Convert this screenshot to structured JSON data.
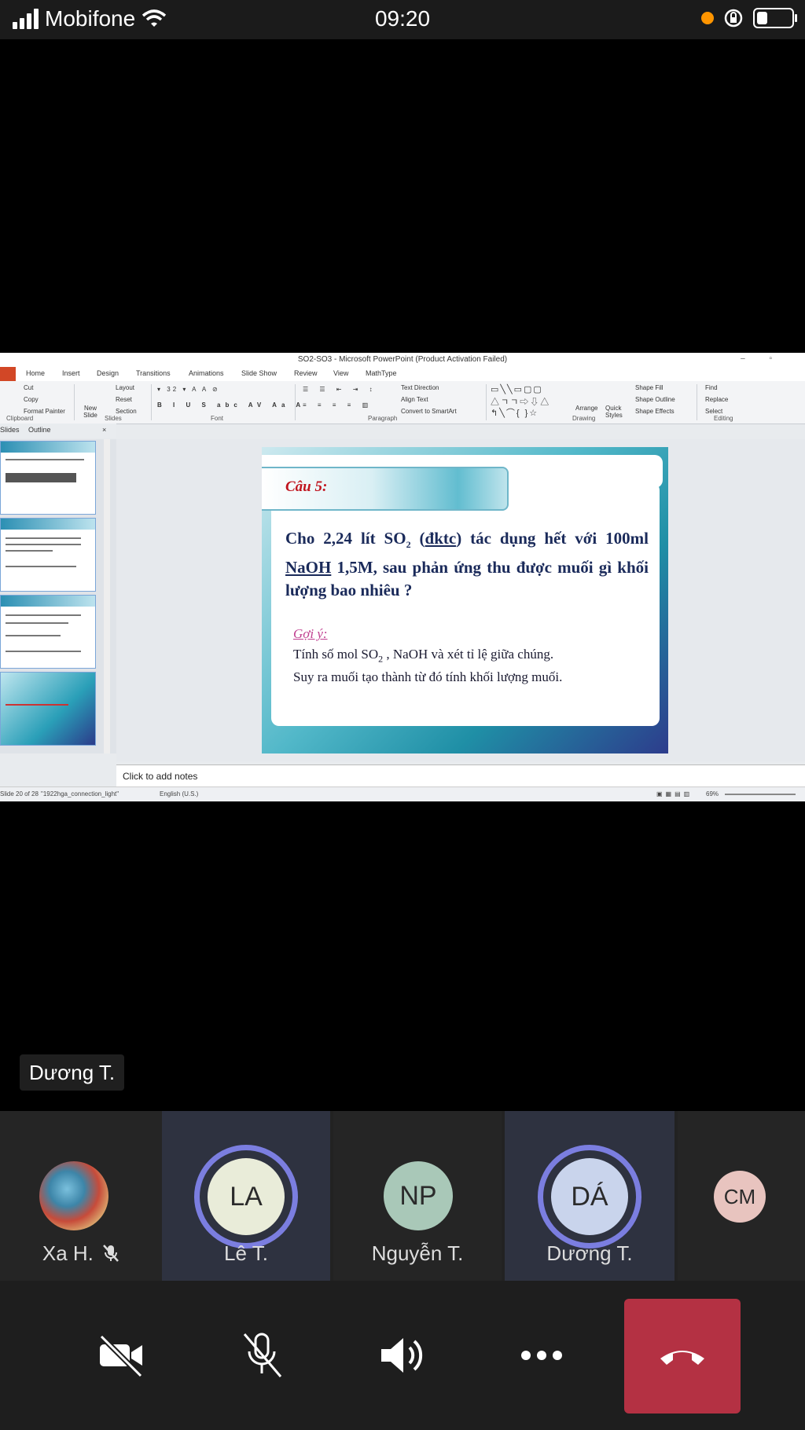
{
  "status_bar": {
    "carrier": "Mobifone",
    "time": "09:20",
    "battery_level": 0.3
  },
  "powerpoint": {
    "window_title": "SO2-SO3 - Microsoft PowerPoint (Product Activation Failed)",
    "tabs": [
      "Home",
      "Insert",
      "Design",
      "Transitions",
      "Animations",
      "Slide Show",
      "Review",
      "View",
      "MathType"
    ],
    "ribbon": {
      "cut": "Cut",
      "copy": "Copy",
      "format_painter": "Format Painter",
      "layout": "Layout",
      "reset": "Reset",
      "new_slide": "New Slide",
      "section": "Section",
      "text_direction": "Text Direction",
      "align_text": "Align Text",
      "convert_smartart": "Convert to SmartArt",
      "arrange": "Arrange",
      "quick_styles": "Quick Styles",
      "shape_fill": "Shape Fill",
      "shape_outline": "Shape Outline",
      "shape_effects": "Shape Effects",
      "find": "Find",
      "replace": "Replace",
      "select": "Select",
      "groups": {
        "clipboard": "Clipboard",
        "slides": "Slides",
        "font": "Font",
        "paragraph": "Paragraph",
        "drawing": "Drawing",
        "editing": "Editing"
      }
    },
    "panel_tabs": {
      "slides": "Slides",
      "outline": "Outline"
    },
    "notes_placeholder": "Click to add notes",
    "status": {
      "slide_count": "Slide 20 of 28",
      "theme": "\"1922hga_connection_light\"",
      "language": "English (U.S.)",
      "zoom": "69%"
    },
    "slide": {
      "label": "Câu 5:",
      "question_pre": "Cho 2,24 lít SO",
      "question_sub": "2",
      "question_mid": " (",
      "question_u1": "đktc",
      "question_mid2": ") tác dụng hết với 100ml ",
      "question_u2": "NaOH",
      "question_post": " 1,5M, sau phản ứng thu được muối gì khối lượng bao nhiêu ?",
      "hint_label": "Gợi ý:",
      "hint_pre": "Tính số mol SO",
      "hint_sub": "2",
      "hint_post": " , NaOH và xét tỉ lệ giữa chúng.",
      "hint_line2": "Suy ra muối tạo thành từ đó tính khối lượng muối."
    }
  },
  "speaker_tag": "Dương T.",
  "participants": [
    {
      "name": "Xa H.",
      "initials": "",
      "muted": true,
      "avatar_color": ""
    },
    {
      "name": "Lê T.",
      "initials": "LA",
      "muted": false,
      "avatar_color": "#e9ecd9"
    },
    {
      "name": "Nguyễn T.",
      "initials": "NP",
      "muted": false,
      "avatar_color": "#a9c8b8"
    },
    {
      "name": "Dương T.",
      "initials": "DÁ",
      "muted": false,
      "avatar_color": "#c9d4ec"
    },
    {
      "name": "",
      "initials": "CM",
      "muted": false,
      "avatar_color": "#e8c4bf"
    }
  ],
  "controls": [
    "camera-off",
    "mic-off",
    "speaker",
    "more",
    "hang-up"
  ]
}
